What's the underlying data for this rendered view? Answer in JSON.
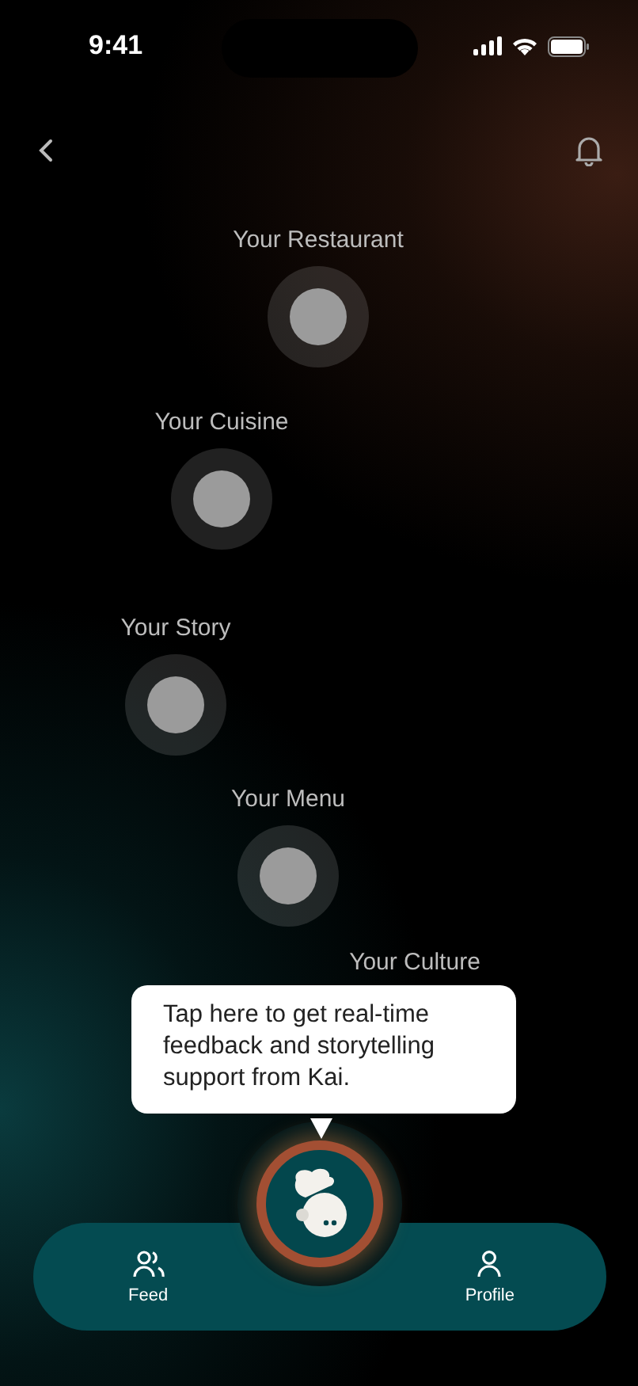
{
  "status_bar": {
    "time": "9:41"
  },
  "nodes": [
    {
      "kind": "step",
      "label": "Your Restaurant"
    },
    {
      "kind": "step",
      "label": "Your Cuisine"
    },
    {
      "kind": "step",
      "label": "Your Story"
    },
    {
      "kind": "step",
      "label": "Your Menu"
    },
    {
      "kind": "label_only",
      "label": "Your Culture"
    }
  ],
  "tooltip": {
    "text": "Tap here to get real-time feedback and storytelling support from Kai."
  },
  "nav": [
    {
      "kind": "feed",
      "label": "Feed"
    },
    {
      "kind": "profile",
      "label": "Profile"
    }
  ]
}
